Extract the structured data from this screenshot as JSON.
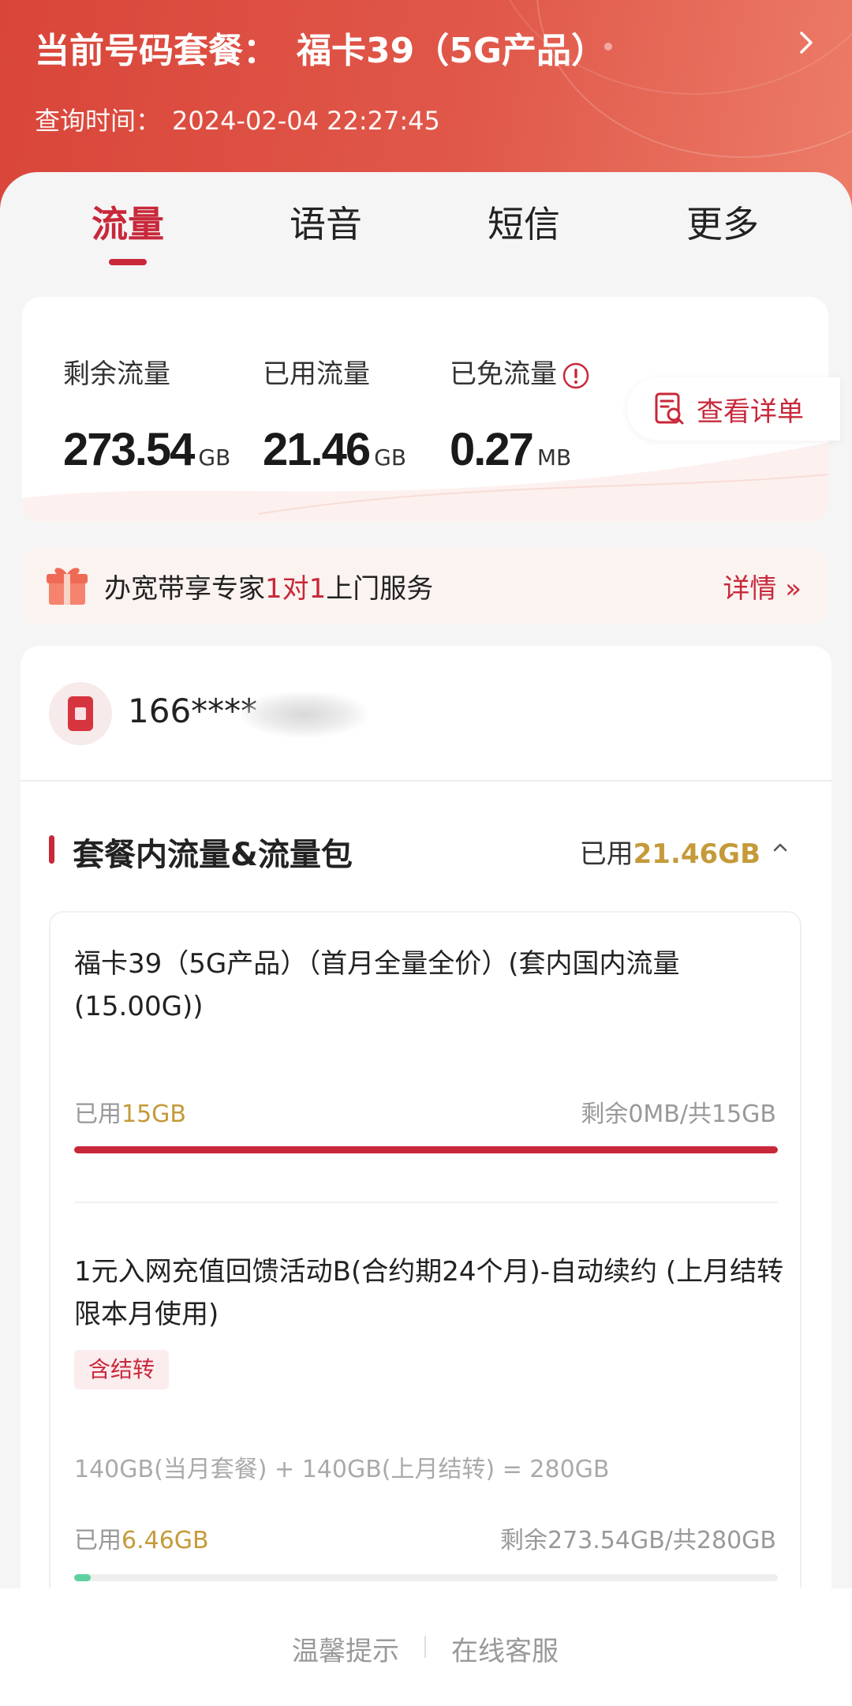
{
  "header": {
    "plan_label": "当前号码套餐：",
    "plan_name": "福卡39（5G产品）",
    "query_time_label": "查询时间：",
    "query_time_value": "2024-02-04 22:27:45"
  },
  "tabs": [
    {
      "label": "流量",
      "active": true
    },
    {
      "label": "语音",
      "active": false
    },
    {
      "label": "短信",
      "active": false
    },
    {
      "label": "更多",
      "active": false
    }
  ],
  "summary": {
    "remaining": {
      "label": "剩余流量",
      "value": "273.54",
      "unit": "GB"
    },
    "used": {
      "label": "已用流量",
      "value": "21.46",
      "unit": "GB"
    },
    "free": {
      "label": "已免流量",
      "value": "0.27",
      "unit": "MB"
    },
    "detail_button": "查看详单"
  },
  "banner": {
    "text_before": "办宽带享专家",
    "text_highlight": "1对1",
    "text_after": "上门服务",
    "link": "详情 »"
  },
  "account": {
    "phone_masked": "166****"
  },
  "section": {
    "title": "套餐内流量&流量包",
    "used_prefix": "已用",
    "used_value": "21.46GB"
  },
  "packages": [
    {
      "name": "福卡39（5G产品）（首月全量全价）(套内国内流量(15.00G))",
      "used_prefix": "已用",
      "used_value": "15GB",
      "remaining": "剩余0MB/共15GB",
      "progress": 1.0
    },
    {
      "name": "1元入网充值回馈活动B(合约期24个月)-自动续约 (上月结转限本月使用)",
      "tag": "含结转",
      "formula": "140GB(当月套餐) + 140GB(上月结转) = 280GB",
      "used_prefix": "已用",
      "used_value": "6.46GB",
      "remaining": "剩余273.54GB/共280GB",
      "progress": 0.023
    }
  ],
  "footer": {
    "tips": "温馨提示",
    "service": "在线客服"
  },
  "colors": {
    "brand_red": "#c8283a",
    "header_gradient_start": "#d94539",
    "header_gradient_end": "#ec7c68",
    "gold": "#c59a3a",
    "progress_full": "#c8283a",
    "progress_low": "#5fd1a0"
  },
  "icons": [
    "chevron-right-icon",
    "info-icon",
    "bill-search-icon",
    "gift-icon",
    "sim-card-icon",
    "chevron-up-icon"
  ]
}
